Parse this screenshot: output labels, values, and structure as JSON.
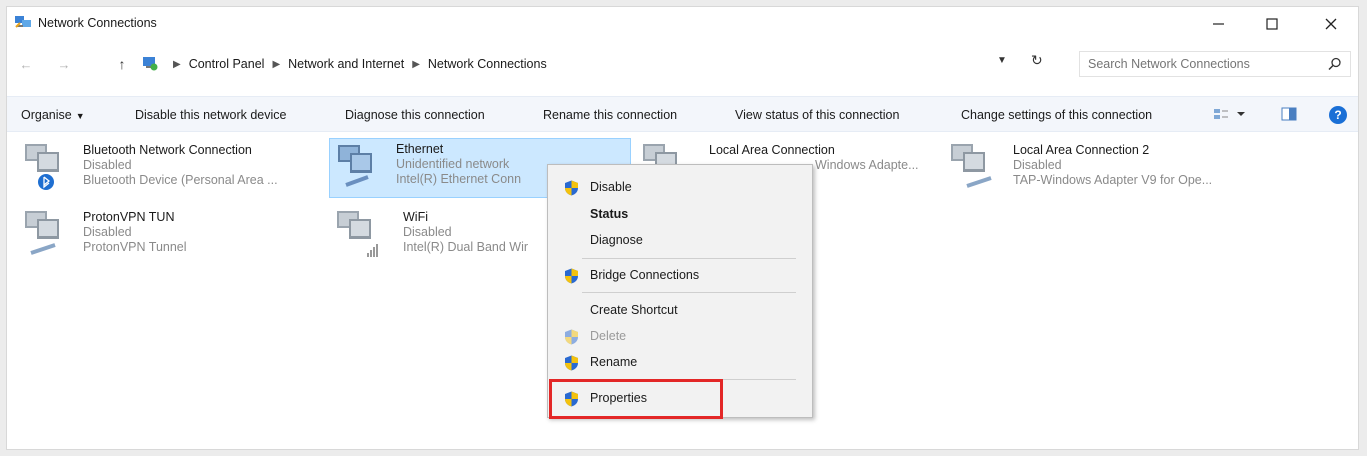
{
  "window": {
    "title": "Network Connections"
  },
  "address": {
    "crumbs": [
      "Control Panel",
      "Network and Internet",
      "Network Connections"
    ],
    "search_placeholder": "Search Network Connections"
  },
  "toolbar": {
    "organise": "Organise",
    "disable_device": "Disable this network device",
    "diagnose": "Diagnose this connection",
    "rename": "Rename this connection",
    "view_status": "View status of this connection",
    "change_settings": "Change settings of this connection"
  },
  "connections": [
    {
      "name": "Bluetooth Network Connection",
      "status": "Disabled",
      "device": "Bluetooth Device (Personal Area ..."
    },
    {
      "name": "Ethernet",
      "status": "Unidentified network",
      "device": "Intel(R) Ethernet Conn"
    },
    {
      "name": "Local Area Connection",
      "status": "",
      "device": "Windows Adapte..."
    },
    {
      "name": "Local Area Connection 2",
      "status": "Disabled",
      "device": "TAP-Windows Adapter V9 for Ope..."
    },
    {
      "name": "ProtonVPN TUN",
      "status": "Disabled",
      "device": "ProtonVPN Tunnel"
    },
    {
      "name": "WiFi",
      "status": "Disabled",
      "device": "Intel(R) Dual Band Wir"
    }
  ],
  "context_menu": {
    "disable": "Disable",
    "status": "Status",
    "diagnose": "Diagnose",
    "bridge": "Bridge Connections",
    "create_shortcut": "Create Shortcut",
    "delete": "Delete",
    "rename": "Rename",
    "properties": "Properties"
  },
  "colors": {
    "selection_bg": "#cce8ff",
    "highlight_border": "#e32727",
    "shield_blue": "#2a6ad1",
    "shield_yellow": "#f4c20d"
  }
}
